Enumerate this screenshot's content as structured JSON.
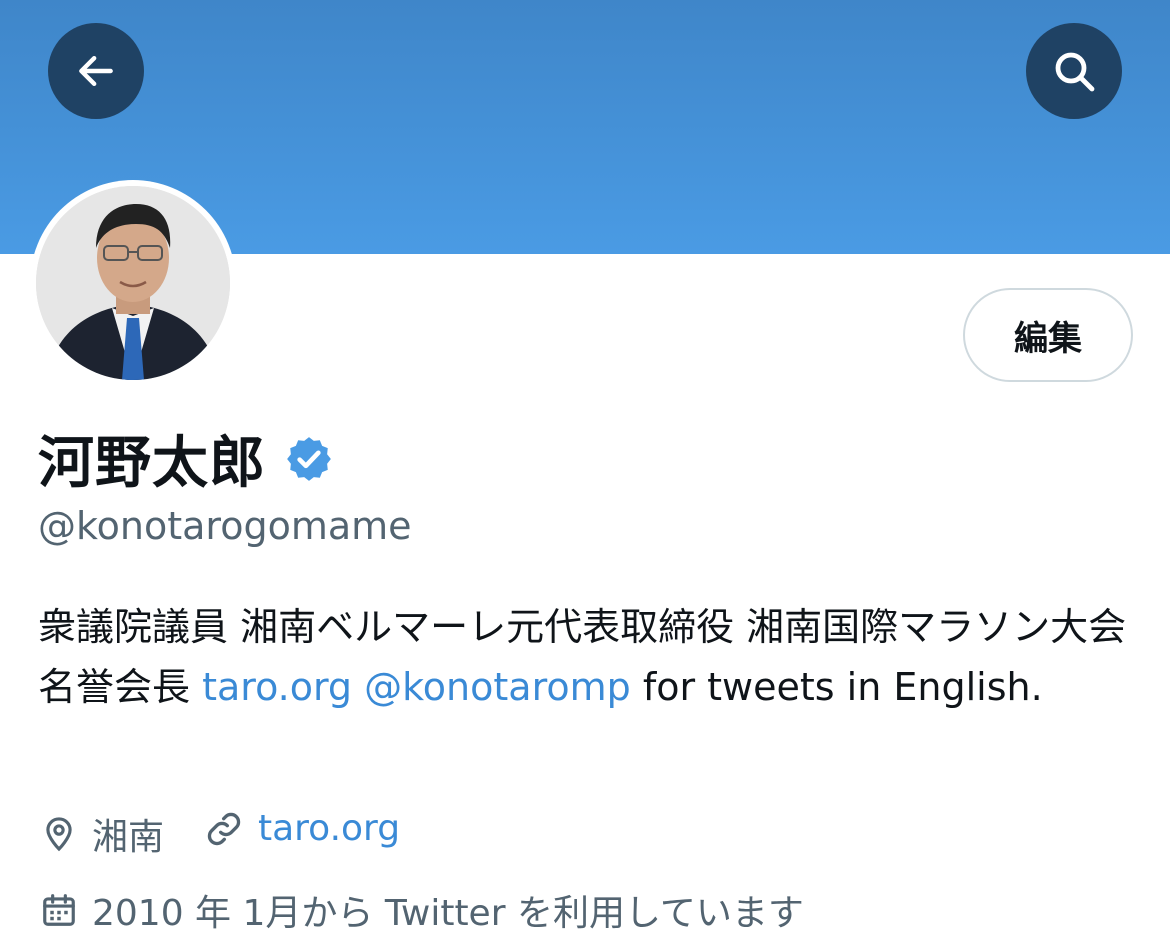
{
  "header": {
    "back_icon": "arrow-left-icon",
    "search_icon": "search-icon",
    "banner_color": "#4a9be4",
    "button_color": "#1f4264"
  },
  "profile": {
    "name": "河野太郎",
    "verified_icon": "verified-badge-icon",
    "verified_color": "#4a9be4",
    "handle": "@konotarogomame",
    "edit_label": "編集",
    "bio": {
      "text1": "衆議院議員 湘南ベルマーレ元代表取締役 湘南国際マラソン大会名誉会長 ",
      "link1": "taro.org",
      "space": " ",
      "link2": "@konotaromp",
      "text2": " for tweets in English."
    },
    "location": "湘南",
    "website": "taro.org",
    "joined": "2010 年 1月から Twitter を利用しています",
    "link_color": "#3a8ad6"
  }
}
